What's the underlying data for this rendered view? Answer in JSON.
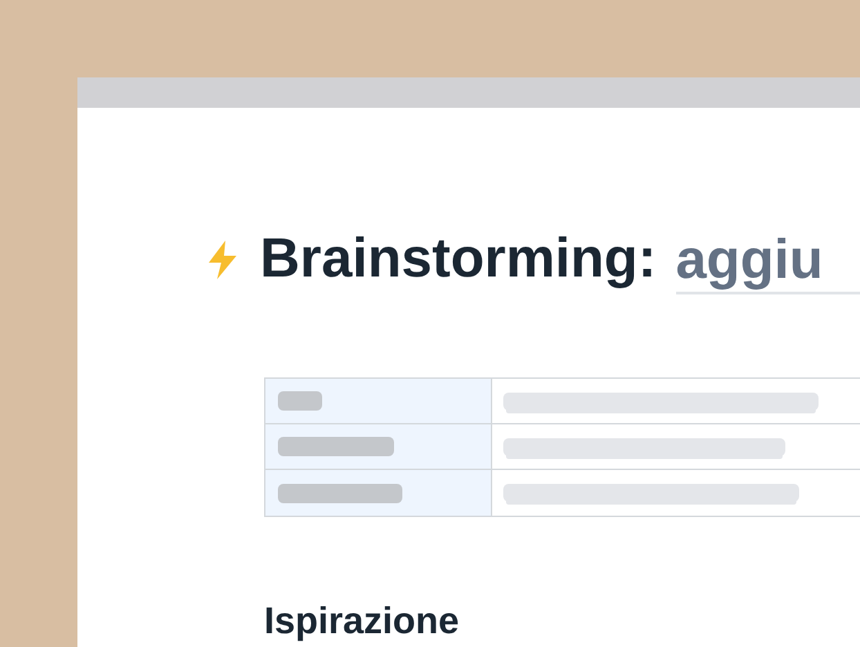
{
  "title": {
    "label": "Brainstorming:",
    "field_value": "aggiu"
  },
  "section_heading": "Ispirazione"
}
